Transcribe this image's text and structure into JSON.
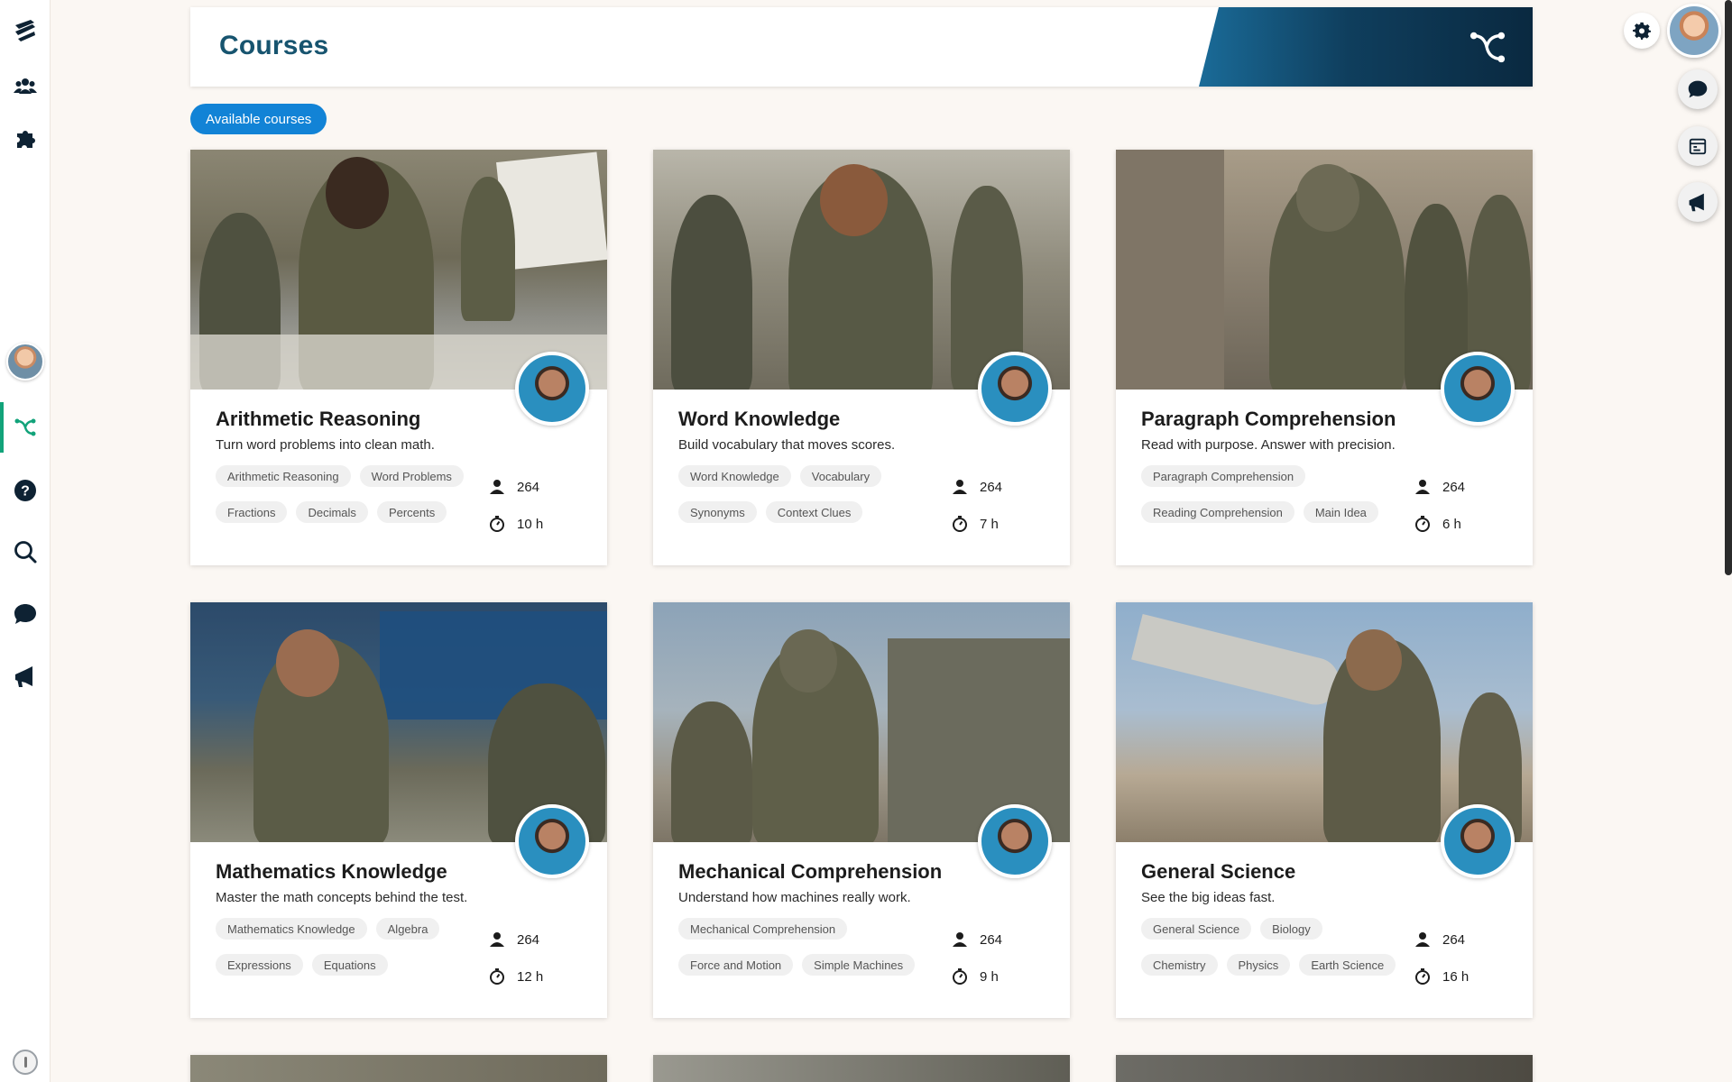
{
  "header": {
    "title": "Courses"
  },
  "filter": {
    "label": "Available courses"
  },
  "colors": {
    "accent": "#1283d6",
    "header_title": "#17546f",
    "active_nav": "#12a37a"
  },
  "sidebar": {
    "items": [
      {
        "name": "logo",
        "icon": "logo-icon"
      },
      {
        "name": "groups",
        "icon": "group-icon"
      },
      {
        "name": "integrations",
        "icon": "puzzle-icon"
      },
      {
        "name": "profile",
        "icon": "avatar"
      },
      {
        "name": "learning-paths",
        "icon": "path-icon",
        "active": true
      },
      {
        "name": "help",
        "icon": "help-icon"
      },
      {
        "name": "search",
        "icon": "search-icon"
      },
      {
        "name": "messages",
        "icon": "chat-icon"
      },
      {
        "name": "announcements",
        "icon": "megaphone-icon"
      }
    ]
  },
  "right_rail": {
    "icons": [
      "gear-icon",
      "chat-icon",
      "calendar-icon",
      "megaphone-icon"
    ]
  },
  "courses": [
    {
      "title": "Arithmetic Reasoning",
      "description": "Turn word problems into clean math.",
      "tags": [
        [
          "Arithmetic Reasoning",
          "Word Problems"
        ],
        [
          "Fractions",
          "Decimals",
          "Percents"
        ]
      ],
      "learners": "264",
      "duration": "10 h"
    },
    {
      "title": "Word Knowledge",
      "description": "Build vocabulary that moves scores.",
      "tags": [
        [
          "Word Knowledge",
          "Vocabulary"
        ],
        [
          "Synonyms",
          "Context Clues"
        ]
      ],
      "learners": "264",
      "duration": "7 h"
    },
    {
      "title": "Paragraph Comprehension",
      "description": "Read with purpose. Answer with precision.",
      "tags": [
        [
          "Paragraph Comprehension"
        ],
        [
          "Reading Comprehension",
          "Main Idea"
        ]
      ],
      "learners": "264",
      "duration": "6 h"
    },
    {
      "title": "Mathematics Knowledge",
      "description": "Master the math concepts behind the test.",
      "tags": [
        [
          "Mathematics Knowledge",
          "Algebra"
        ],
        [
          "Expressions",
          "Equations"
        ]
      ],
      "learners": "264",
      "duration": "12 h"
    },
    {
      "title": "Mechanical Comprehension",
      "description": "Understand how machines really work.",
      "tags": [
        [
          "Mechanical Comprehension"
        ],
        [
          "Force and Motion",
          "Simple Machines"
        ]
      ],
      "learners": "264",
      "duration": "9 h"
    },
    {
      "title": "General Science",
      "description": "See the big ideas fast.",
      "tags": [
        [
          "General Science",
          "Biology"
        ],
        [
          "Chemistry",
          "Physics",
          "Earth Science"
        ]
      ],
      "learners": "264",
      "duration": "16 h"
    }
  ]
}
